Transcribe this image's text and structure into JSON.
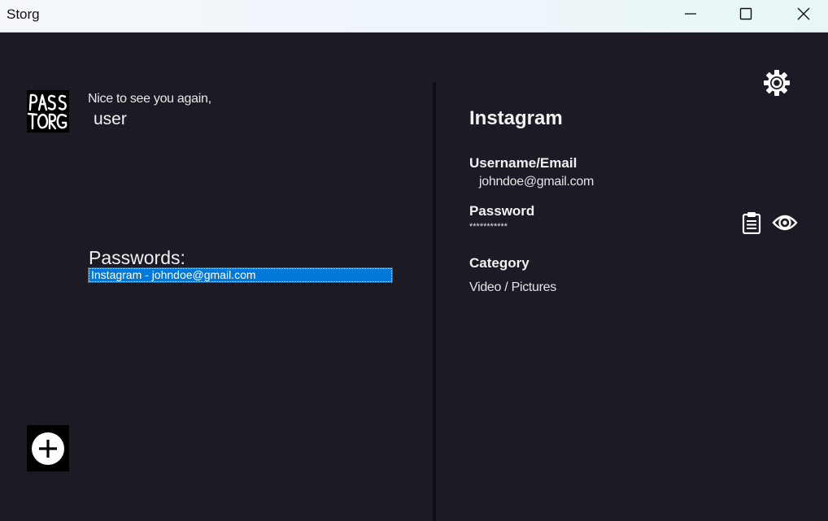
{
  "window": {
    "title": "Storg",
    "minimize_icon": "minimize-icon",
    "maximize_icon": "maximize-icon",
    "close_icon": "close-icon"
  },
  "sidebar": {
    "logo_icon": "passtorg-logo",
    "greeting": "Nice to see you again,",
    "username": "user",
    "passwords_label": "Passwords:",
    "passwords": [
      {
        "label": "Instagram - johndoe@gmail.com",
        "selected": true
      }
    ],
    "add_icon": "plus-circle-icon"
  },
  "detail": {
    "settings_icon": "gear-icon",
    "title": "Instagram",
    "username_label": "Username/Email",
    "username_value": "johndoe@gmail.com",
    "password_label": "Password",
    "password_value": "***********",
    "copy_icon": "clipboard-icon",
    "reveal_icon": "eye-icon",
    "category_label": "Category",
    "category_value": "Video / Pictures"
  },
  "colors": {
    "background": "#1c1b25",
    "selection": "#0078d7",
    "text": "#f2f2f2",
    "divider": "#0e0e12"
  }
}
